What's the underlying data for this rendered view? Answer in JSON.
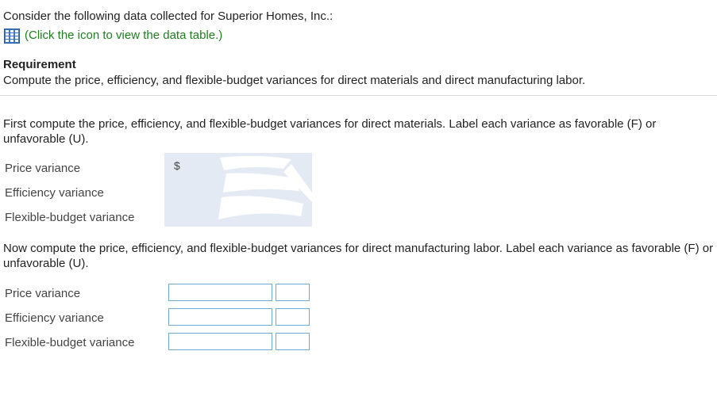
{
  "intro": {
    "text": "Consider the following data collected for Superior Homes, Inc.:",
    "link_text": "(Click the icon to view the data table.)",
    "icon": "table-icon"
  },
  "requirement": {
    "title": "Requirement",
    "body": "Compute the price, efficiency, and flexible-budget variances for direct materials and direct manufacturing labor."
  },
  "materials": {
    "instruction": "First compute the price, efficiency, and flexible-budget variances for direct materials. Label each variance as favorable (F) or unfavorable (U).",
    "currency": "$",
    "rows": [
      {
        "label": "Price variance"
      },
      {
        "label": "Efficiency variance"
      },
      {
        "label": "Flexible-budget variance"
      }
    ]
  },
  "labor": {
    "instruction": "Now compute the price, efficiency, and flexible-budget variances for direct manufacturing labor. Label each variance as favorable (F) or unfavorable (U).",
    "rows": [
      {
        "label": "Price variance",
        "amount": "",
        "fu": ""
      },
      {
        "label": "Efficiency variance",
        "amount": "",
        "fu": ""
      },
      {
        "label": "Flexible-budget variance",
        "amount": "",
        "fu": ""
      }
    ]
  },
  "colors": {
    "link": "#1e7e1e",
    "input_border": "#6fa9d6",
    "answer_area": "#e4eaf4"
  }
}
